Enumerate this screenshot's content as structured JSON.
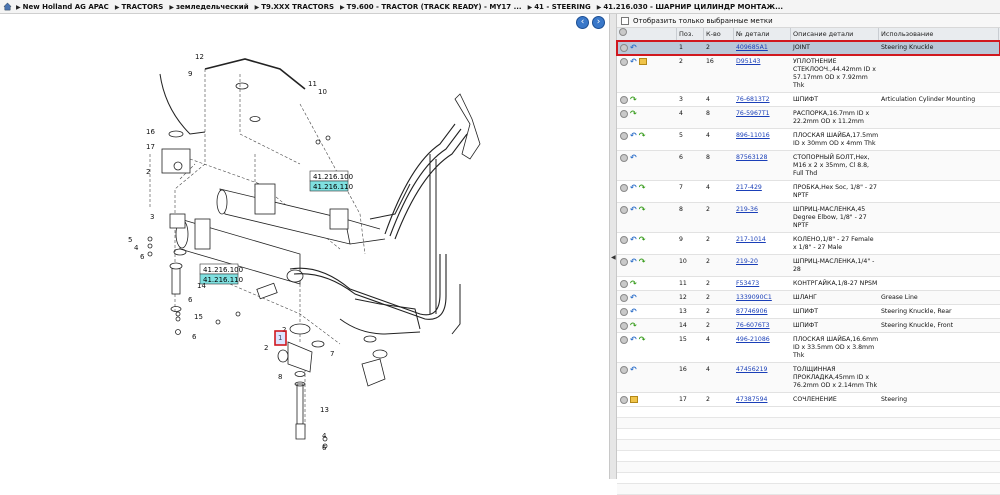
{
  "breadcrumb": [
    "New Holland AG APAC",
    "TRACTORS",
    "земледельческий",
    "T9.XXX TRACTORS",
    "T9.600 - TRACTOR (TRACK READY) - MY17 ...",
    "41 - STEERING",
    "41.216.030 - ШАРНИР ЦИЛИНДР МОНТАЖ..."
  ],
  "drawing": {
    "ref_labels": [
      "41.216.100",
      "41.216.110",
      "41.216.100",
      "41.216.110"
    ],
    "callouts": [
      "12",
      "9",
      "11",
      "10",
      "16",
      "17",
      "2",
      "3",
      "5",
      "4",
      "6",
      "14",
      "6",
      "15",
      "6",
      "1",
      "2",
      "7",
      "8",
      "2",
      "13",
      "4",
      "6"
    ]
  },
  "filter": {
    "label": "Отобразить только выбранные метки"
  },
  "table": {
    "headers": [
      "Поз.",
      "К-во",
      "№ детали",
      "Описание детали",
      "Использование"
    ],
    "rows": [
      {
        "pos": "1",
        "qty": "2",
        "part": "409685A1",
        "desc": "JOINT",
        "usage": "Steering Knuckle",
        "icons": [
          "cart",
          "arrow"
        ],
        "selected": true
      },
      {
        "pos": "2",
        "qty": "16",
        "part": "D95143",
        "desc": "УПЛОТНЕНИЕ СТЕКЛООЧ.,44.42mm ID x 57.17mm OD x 7.92mm Thk",
        "usage": "",
        "icons": [
          "cart",
          "arrow",
          "box"
        ]
      },
      {
        "pos": "3",
        "qty": "4",
        "part": "76-6813T2",
        "desc": "ШПИФТ",
        "usage": "Articulation Cylinder Mounting",
        "icons": [
          "cart",
          "green"
        ]
      },
      {
        "pos": "4",
        "qty": "8",
        "part": "76-5967T1",
        "desc": "РАСПОРКА,16.7mm ID x 22.2mm OD x 11.2mm",
        "usage": "",
        "icons": [
          "cart",
          "green"
        ]
      },
      {
        "pos": "5",
        "qty": "4",
        "part": "896-11016",
        "desc": "ПЛОСКАЯ ШАЙБА,17.5mm ID x 30mm OD x 4mm Thk",
        "usage": "",
        "icons": [
          "cart",
          "arrow",
          "green"
        ]
      },
      {
        "pos": "6",
        "qty": "8",
        "part": "87563128",
        "desc": "СТОПОРНЫЙ БОЛТ,Hex, M16 x 2 x 35mm, Cl 8.8, Full Thd",
        "usage": "",
        "icons": [
          "cart",
          "arrow"
        ]
      },
      {
        "pos": "7",
        "qty": "4",
        "part": "217-429",
        "desc": "ПРОБКА,Hex Soc, 1/8\" - 27 NPTF",
        "usage": "",
        "icons": [
          "cart",
          "arrow",
          "green"
        ]
      },
      {
        "pos": "8",
        "qty": "2",
        "part": "219-36",
        "desc": "ШПРИЦ-МАСЛЕНКА,45 Degree Elbow, 1/8\" - 27 NPTF",
        "usage": "",
        "icons": [
          "cart",
          "arrow",
          "green"
        ]
      },
      {
        "pos": "9",
        "qty": "2",
        "part": "217-1014",
        "desc": "КОЛЕНО,1/8\" - 27 Female x 1/8\" - 27 Male",
        "usage": "",
        "icons": [
          "cart",
          "arrow",
          "green"
        ]
      },
      {
        "pos": "10",
        "qty": "2",
        "part": "219-20",
        "desc": "ШПРИЦ-МАСЛЕНКА,1/4\" - 28",
        "usage": "",
        "icons": [
          "cart",
          "arrow",
          "green"
        ]
      },
      {
        "pos": "11",
        "qty": "2",
        "part": "F53473",
        "desc": "КОНТРГАЙКА,1/8-27 NPSM",
        "usage": "",
        "icons": [
          "cart",
          "green"
        ]
      },
      {
        "pos": "12",
        "qty": "2",
        "part": "1339090C1",
        "desc": "ШЛАНГ",
        "usage": "Grease Line",
        "icons": [
          "cart",
          "arrow"
        ]
      },
      {
        "pos": "13",
        "qty": "2",
        "part": "87746906",
        "desc": "ШПИФТ",
        "usage": "Steering Knuckle, Rear",
        "icons": [
          "cart",
          "arrow"
        ]
      },
      {
        "pos": "14",
        "qty": "2",
        "part": "76-6076T3",
        "desc": "ШПИФТ",
        "usage": "Steering Knuckle, Front",
        "icons": [
          "cart",
          "green"
        ]
      },
      {
        "pos": "15",
        "qty": "4",
        "part": "496-21086",
        "desc": "ПЛОСКАЯ ШАЙБА,16.6mm ID x 33.5mm OD x 3.8mm Thk",
        "usage": "",
        "icons": [
          "cart",
          "arrow",
          "green"
        ]
      },
      {
        "pos": "16",
        "qty": "4",
        "part": "47456219",
        "desc": "ТОЛЩИННАЯ ПРОКЛАДКА,45mm ID x 76.2mm OD x 2.14mm Thk",
        "usage": "",
        "icons": [
          "cart",
          "arrow"
        ]
      },
      {
        "pos": "17",
        "qty": "2",
        "part": "47387594",
        "desc": "СОЧЛЕНЕНИЕ",
        "usage": "Steering",
        "icons": [
          "cart",
          "box"
        ]
      }
    ]
  },
  "colors": {
    "selected_row": "#bac8d8",
    "highlight_border": "#d0181f",
    "link": "#1a3fb8",
    "nav_button": "#3a78c9",
    "ref_label_fill": "#7fe0e0"
  }
}
